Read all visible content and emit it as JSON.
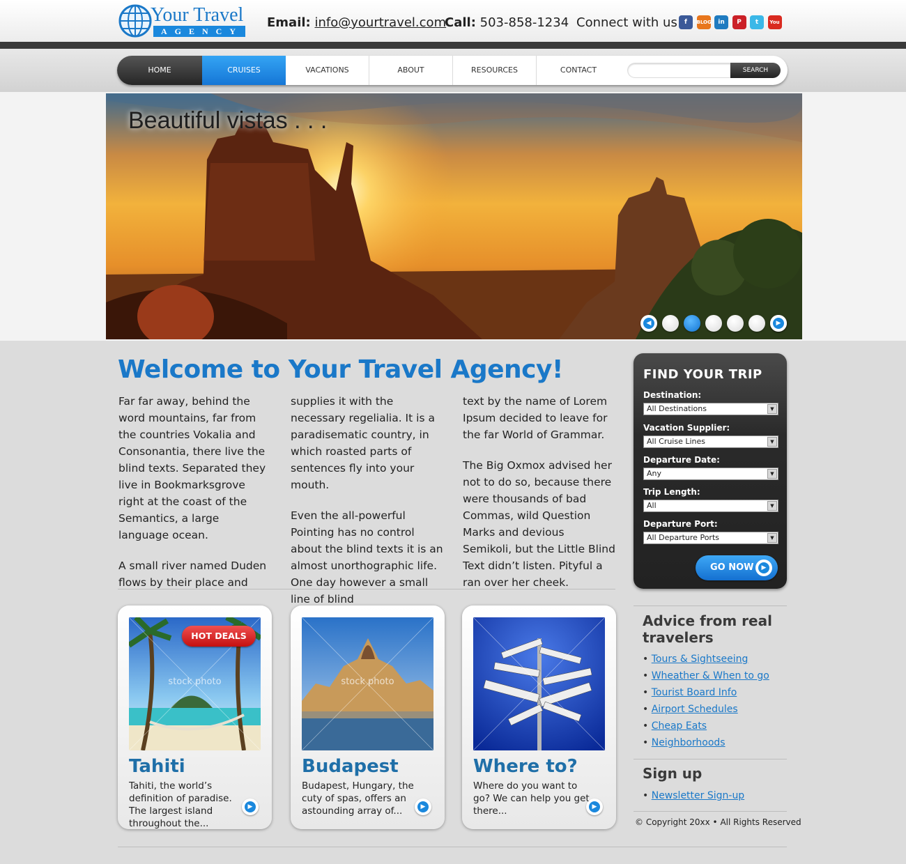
{
  "header": {
    "logo_title": "Your Travel",
    "logo_subtitle": "AGENCY",
    "email_label": "Email:",
    "email_value": "info@yourtravel.com",
    "call_label": "Call:",
    "call_value": "503-858-1234",
    "connect_label": "Connect with us:",
    "social": [
      {
        "name": "facebook-icon",
        "glyph": "f",
        "color": "#3b5998"
      },
      {
        "name": "blog-icon",
        "glyph": "BLOG",
        "color": "#e8761c"
      },
      {
        "name": "linkedin-icon",
        "glyph": "in",
        "color": "#1f7bc0"
      },
      {
        "name": "pinterest-icon",
        "glyph": "P",
        "color": "#cb2027"
      },
      {
        "name": "twitter-icon",
        "glyph": "t",
        "color": "#3bb8e8"
      },
      {
        "name": "youtube-icon",
        "glyph": "You",
        "color": "#d92a20"
      }
    ]
  },
  "nav": {
    "items": [
      "HOME",
      "CRUISES",
      "VACATIONS",
      "ABOUT",
      "RESOURCES",
      "CONTACT"
    ],
    "search_placeholder": "",
    "search_label": "SEARCH"
  },
  "hero": {
    "caption": "Beautiful vistas . . .",
    "slides": 6,
    "active_slide": 2
  },
  "welcome": {
    "title": "Welcome to Your Travel Agency!",
    "col1": [
      "Far far away, behind the word mountains, far from the countries Vokalia and Consonantia, there live the blind texts. Separated they live in Bookmarksgrove right at the coast of the Semantics, a large language ocean.",
      "A small river named Duden flows by their place and"
    ],
    "col2": [
      "supplies it with the necessary regelialia. It is a paradisematic country, in which roasted parts of sentences fly into your mouth.",
      "Even the all-powerful Pointing has no control about the blind texts it is an almost unorthographic life. One day however a small line of blind"
    ],
    "col3": [
      "text by the name of Lorem Ipsum decided to leave for the far World of Grammar.",
      "The Big Oxmox advised her not to do so, because there were thousands of bad Commas, wild Question Marks and devious Semikoli, but the Little Blind Text didn’t listen. Pityful a ran over her cheek."
    ]
  },
  "trip": {
    "title": "FIND YOUR TRIP",
    "fields": [
      {
        "label": "Destination:",
        "value": "All Destinations"
      },
      {
        "label": "Vacation Supplier:",
        "value": "All Cruise Lines"
      },
      {
        "label": "Departure Date:",
        "value": "Any"
      },
      {
        "label": "Trip Length:",
        "value": "All"
      },
      {
        "label": "Departure Port:",
        "value": "All Departure Ports"
      }
    ],
    "button": "GO NOW"
  },
  "cards": [
    {
      "title": "Tahiti",
      "text": "Tahiti, the world’s definition of paradise. The largest island throughout the...",
      "badge": "HOT DEALS",
      "watermark": "stock photo"
    },
    {
      "title": "Budapest",
      "text": "Budapest, Hungary, the cuty of spas, offers an astounding array of...",
      "watermark": "stock photo"
    },
    {
      "title": "Where to?",
      "text": "Where do you want to go? We can help you get there..."
    }
  ],
  "sidebar": {
    "advice_title": "Advice from real travelers",
    "advice_links": [
      "Tours & Sightseeing",
      "Wheather & When to go",
      "Tourist Board Info",
      "Airport Schedules",
      "Cheap Eats",
      "Neighborhoods"
    ],
    "signup_title": "Sign up",
    "signup_links": [
      "Newsletter Sign-up"
    ],
    "copyright": "© Copyright 20xx • All Rights Reserved"
  }
}
